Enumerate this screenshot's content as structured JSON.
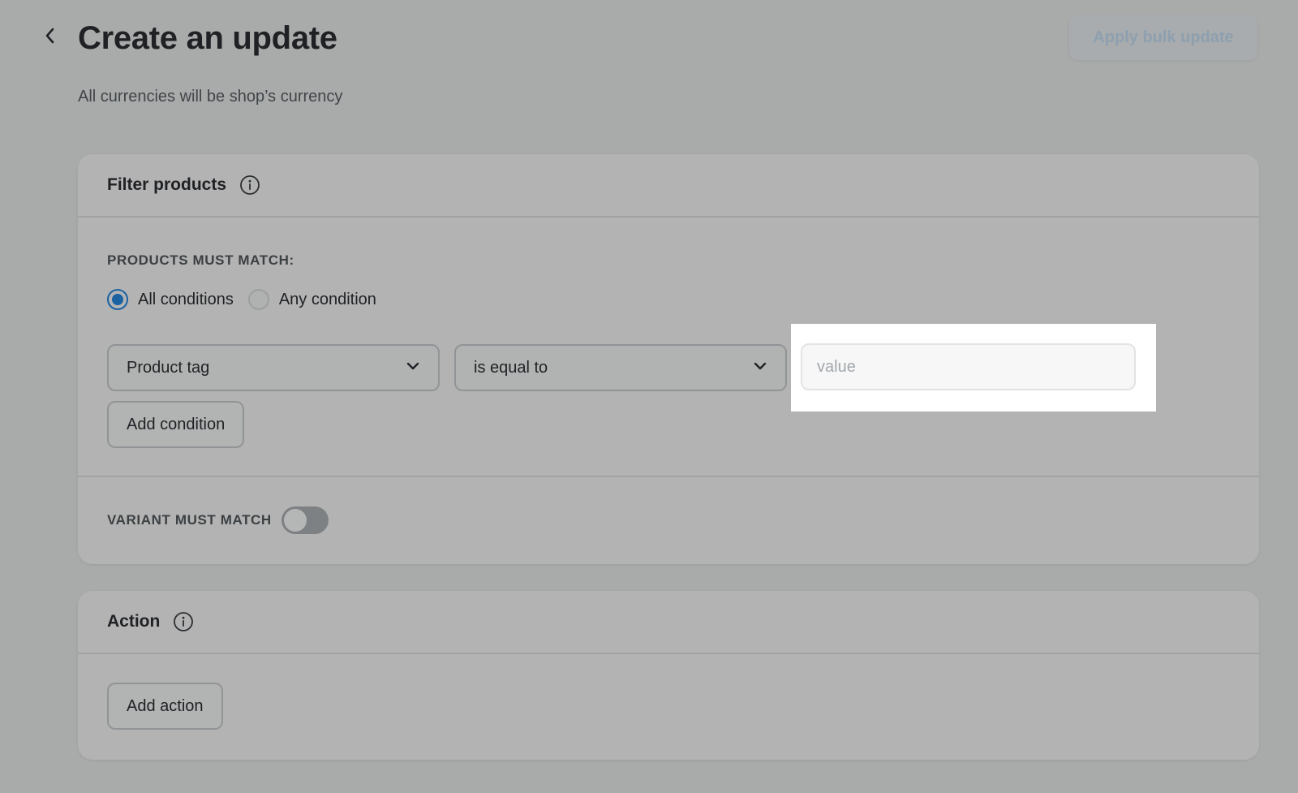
{
  "header": {
    "back_icon": "chevron-left-icon",
    "title": "Create an update",
    "apply_button_label": "Apply bulk update",
    "subtitle": "All currencies will be shop’s currency"
  },
  "filter_card": {
    "title": "Filter products",
    "info_icon": "info-icon",
    "match_label": "PRODUCTS MUST MATCH:",
    "match_options": [
      {
        "label": "All conditions",
        "selected": true
      },
      {
        "label": "Any condition",
        "selected": false
      }
    ],
    "condition": {
      "attribute": "Product tag",
      "operator": "is equal to",
      "value": "",
      "value_placeholder": "value"
    },
    "add_condition_label": "Add condition",
    "variant_label": "VARIANT MUST MATCH",
    "variant_toggle_on": false
  },
  "action_card": {
    "title": "Action",
    "info_icon": "info-icon",
    "add_action_label": "Add action"
  },
  "colors": {
    "accent": "#1b62a2",
    "overlay_background": "#a9abab",
    "highlight": "#ffffff"
  }
}
